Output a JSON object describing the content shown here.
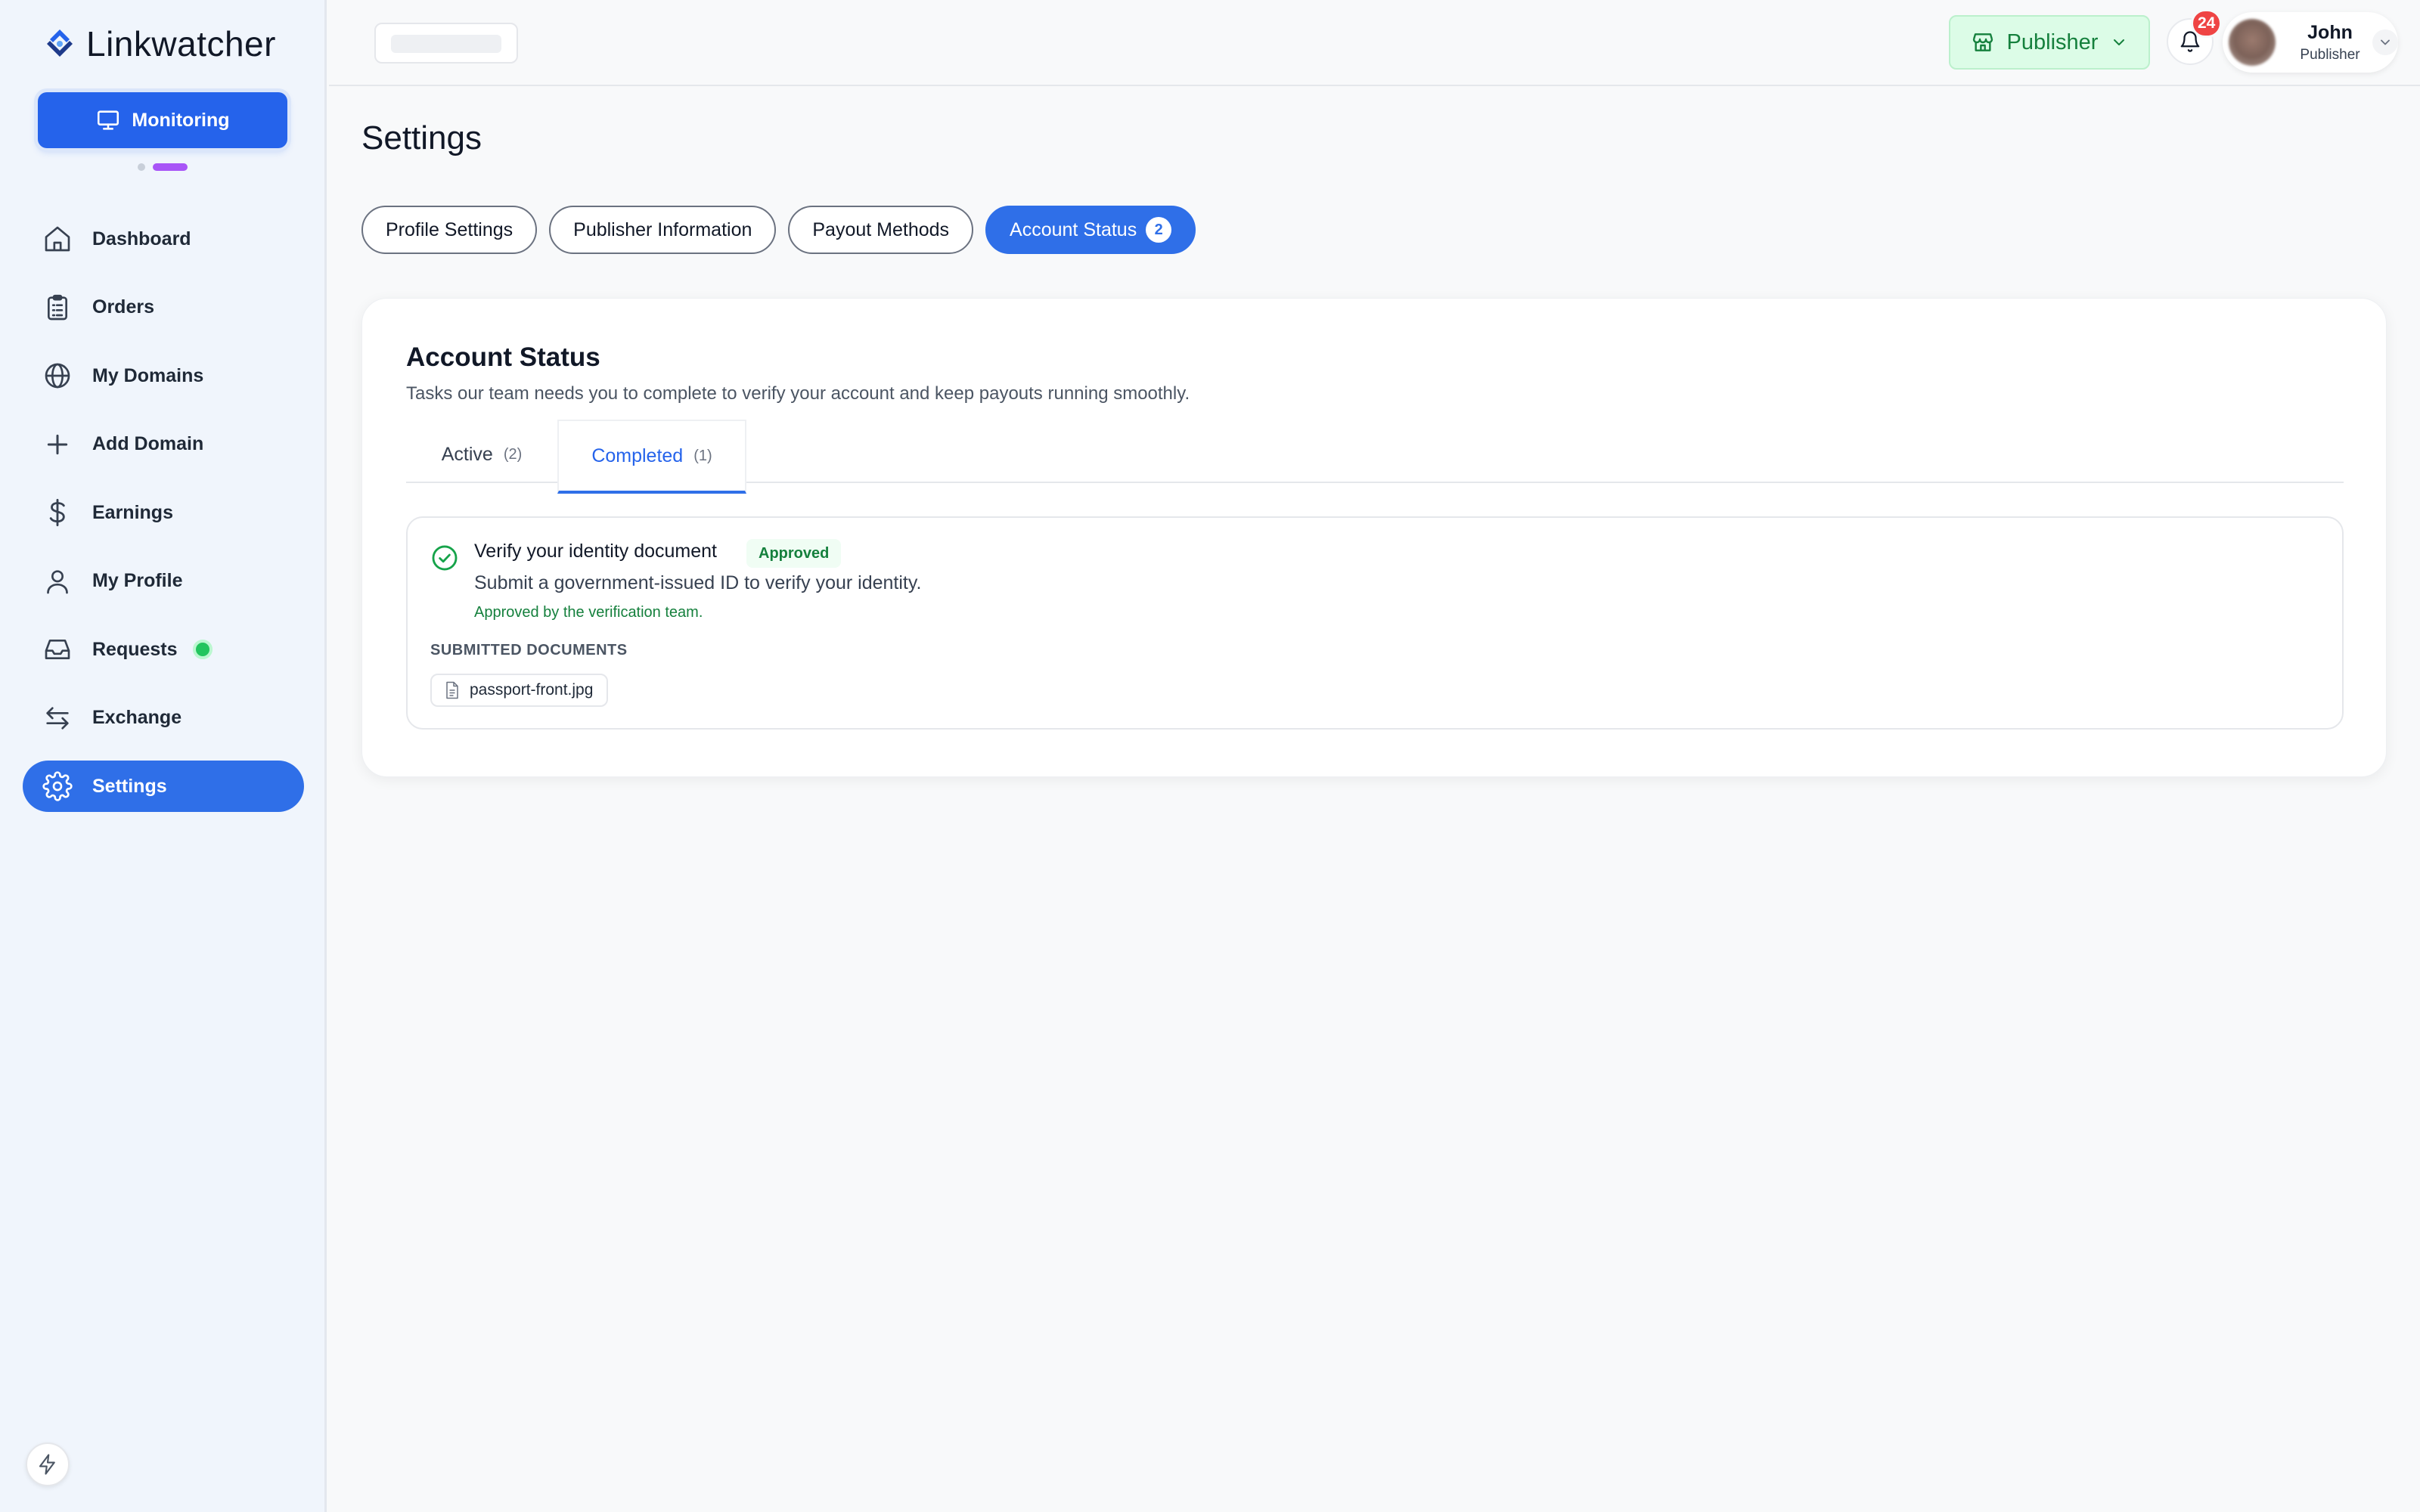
{
  "brand": {
    "name": "Linkwatcher"
  },
  "sidebar": {
    "monitor_label": "Monitoring",
    "items": [
      {
        "label": "Dashboard",
        "icon": "home-icon"
      },
      {
        "label": "Orders",
        "icon": "clipboard-icon"
      },
      {
        "label": "My Domains",
        "icon": "globe-icon"
      },
      {
        "label": "Add Domain",
        "icon": "plus-icon"
      },
      {
        "label": "Earnings",
        "icon": "dollar-icon"
      },
      {
        "label": "My Profile",
        "icon": "user-icon"
      },
      {
        "label": "Requests",
        "icon": "inbox-icon"
      },
      {
        "label": "Exchange",
        "icon": "exchange-icon"
      },
      {
        "label": "Settings",
        "icon": "gear-icon"
      }
    ],
    "active_item": "Settings"
  },
  "header": {
    "role_label": "Publisher",
    "notification_count": "24",
    "user": {
      "name": "John",
      "role": "Publisher"
    }
  },
  "page": {
    "title": "Settings",
    "tabs": [
      {
        "label": "Profile Settings"
      },
      {
        "label": "Publisher Information"
      },
      {
        "label": "Payout Methods"
      },
      {
        "label": "Account Status",
        "count": "2"
      }
    ]
  },
  "account_status": {
    "title": "Account Status",
    "subtitle": "Tasks our team needs you to complete to verify your account and keep payouts running smoothly.",
    "subtabs": [
      {
        "label": "Active",
        "count": "(2)"
      },
      {
        "label": "Completed",
        "count": "(1)"
      }
    ],
    "task": {
      "title": "Verify your identity document",
      "status": "Approved",
      "description": "Submit a government-issued ID to verify your identity.",
      "note": "Approved by the verification team.",
      "docs_label": "SUBMITTED DOCUMENTS",
      "document": "passport-front.jpg"
    }
  },
  "colors": {
    "primary": "#2f6fe8",
    "success": "#15803d",
    "badge_red": "#ef4444",
    "accent_purple": "#a855f7"
  }
}
